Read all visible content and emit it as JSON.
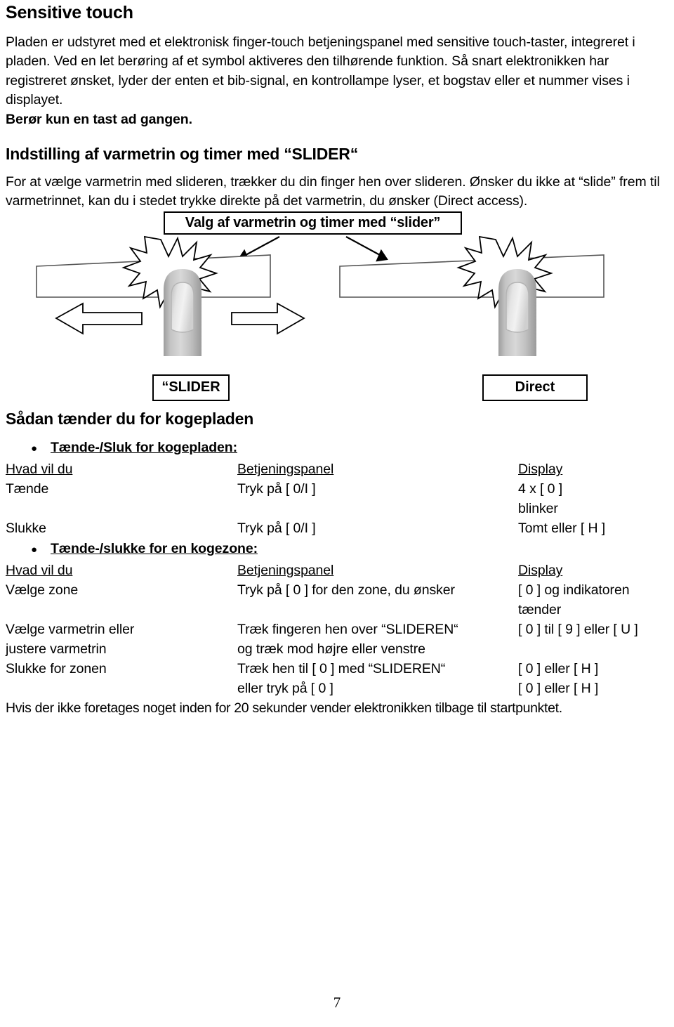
{
  "document": {
    "page_number": "7"
  },
  "section_sensitive_touch": {
    "heading": "Sensitive touch",
    "paragraph_lines": [
      "Pladen er udstyret med et elektronisk finger-touch betjeningspanel med sensitive touch-taster,",
      "integreret i pladen. Ved en let berøring af et symbol aktiveres den tilhørende funktion. Så snart",
      "elektronikken har registreret ønsket, lyder der enten et bib-signal, en kontrollampe lyser, et",
      "bogstav eller et nummer vises i displayet."
    ],
    "warning": "Berør kun en tast ad gangen."
  },
  "section_slider": {
    "heading": "Indstilling af varmetrin og timer med “SLIDER“",
    "paragraph_lines": [
      "For at vælge varmetrin med slideren, trækker du din finger hen over slideren. Ønsker du ikke at",
      "“slide” frem til varmetrinnet, kan du i stedet trykke direkte på det varmetrin, du ønsker (Direct",
      "access)."
    ],
    "figure": {
      "caption": "Valg af varmetrin og timer med “slider”",
      "label_left": "“SLIDER",
      "label_right": "Direct"
    }
  },
  "section_power_on": {
    "heading": "Sådan tænder du for kogepladen",
    "bullet_symbol": "●",
    "table1": {
      "bullet_heading": "Tænde-/Sluk for kogepladen:",
      "headers": [
        "Hvad vil du",
        "Betjeningspanel",
        "Display"
      ],
      "rows": [
        {
          "what": "Tænde",
          "panel": "Tryk på [ 0/I ]",
          "display_line1": "4 x [ 0 ]",
          "display_line2": "blinker"
        },
        {
          "what": "Slukke",
          "panel": "Tryk på [ 0/I ]",
          "display_line1": "Tomt eller [ H ]",
          "display_line2": ""
        }
      ]
    },
    "table2": {
      "bullet_heading": "Tænde-/slukke for en kogezone:",
      "headers": [
        "Hvad vil du",
        "Betjeningspanel",
        "Display"
      ],
      "rows": [
        {
          "what_line1": "Vælge zone",
          "what_line2": "",
          "panel_line1": "Tryk på [ 0 ] for den zone, du ønsker",
          "panel_line2": "",
          "display_line1": "[ 0 ] og indikatoren",
          "display_line2": "tænder"
        },
        {
          "what_line1": "Vælge varmetrin eller",
          "what_line2": "justere varmetrin",
          "panel_line1": "Træk fingeren hen over “SLIDEREN“",
          "panel_line2": "og træk mod højre eller venstre",
          "display_line1": "[ 0 ] til [ 9 ] eller [ U ]",
          "display_line2": ""
        },
        {
          "what_line1": "Slukke for zonen",
          "what_line2": "",
          "panel_line1": "Træk hen til [ 0 ] med “SLIDEREN“",
          "panel_line2": "eller tryk på [ 0 ]",
          "display_line1": "[ 0 ] eller [ H ]",
          "display_line2": "[ 0 ] eller [ H ]"
        }
      ]
    },
    "footnote": "Hvis der ikke foretages noget inden for 20 sekunder vender elektronikken tilbage til startpunktet."
  }
}
